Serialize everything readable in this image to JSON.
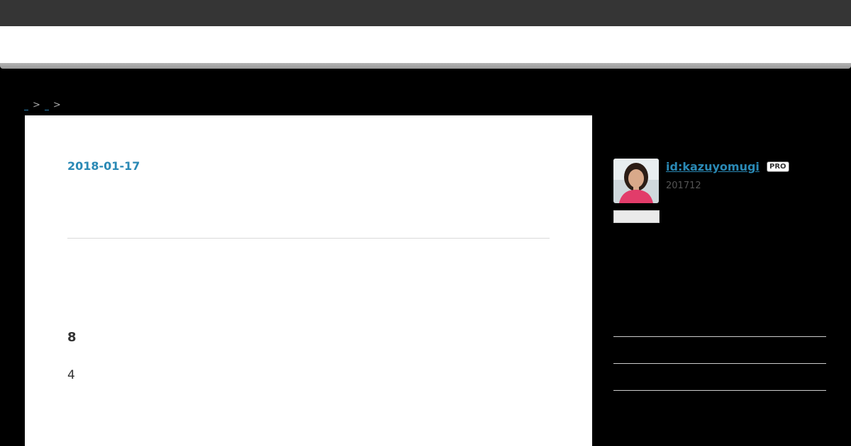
{
  "breadcrumb": {
    "separator": ">"
  },
  "entry": {
    "date": "2018-01-17",
    "heading": "8",
    "paragraph": "4"
  },
  "profile": {
    "username": "id:kazuyomugi",
    "badge": "PRO",
    "since": "201712"
  },
  "colors": {
    "link": "#2a89b5",
    "topbar": "#353535",
    "background": "#000000"
  }
}
